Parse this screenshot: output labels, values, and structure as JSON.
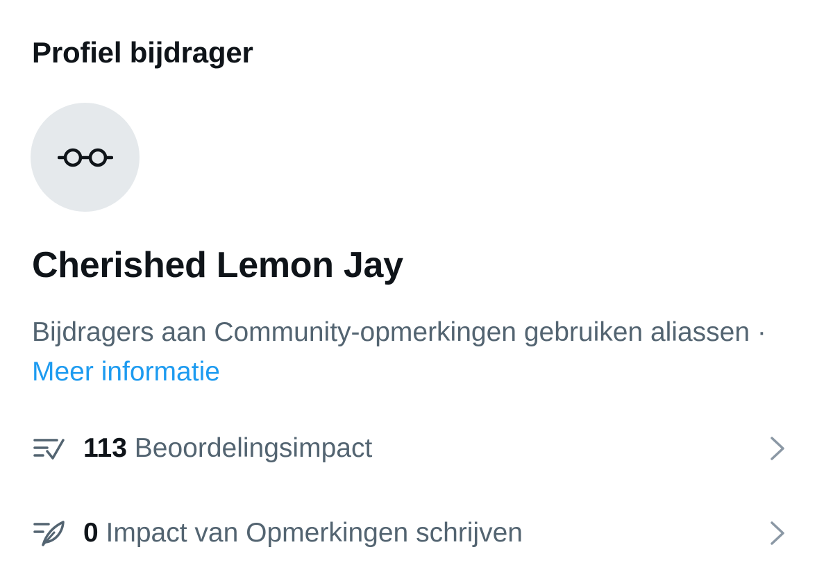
{
  "header": {
    "title": "Profiel bijdrager"
  },
  "profile": {
    "avatar_icon": "glasses-icon",
    "name": "Cherished Lemon Jay",
    "description_text": "Bijdragers aan Community-opmerkingen gebruiken aliassen",
    "separator": "·",
    "learn_more_label": "Meer informatie"
  },
  "stats": [
    {
      "icon": "rating-check-icon",
      "value": "113",
      "label": "Beoordelingsimpact"
    },
    {
      "icon": "writing-feather-icon",
      "value": "0",
      "label": "Impact van Opmerkingen schrijven"
    }
  ],
  "colors": {
    "text_primary": "#0f1419",
    "text_secondary": "#536471",
    "link": "#1d9bf0",
    "avatar_bg": "#e5e9ec",
    "chevron": "#8b98a5"
  }
}
